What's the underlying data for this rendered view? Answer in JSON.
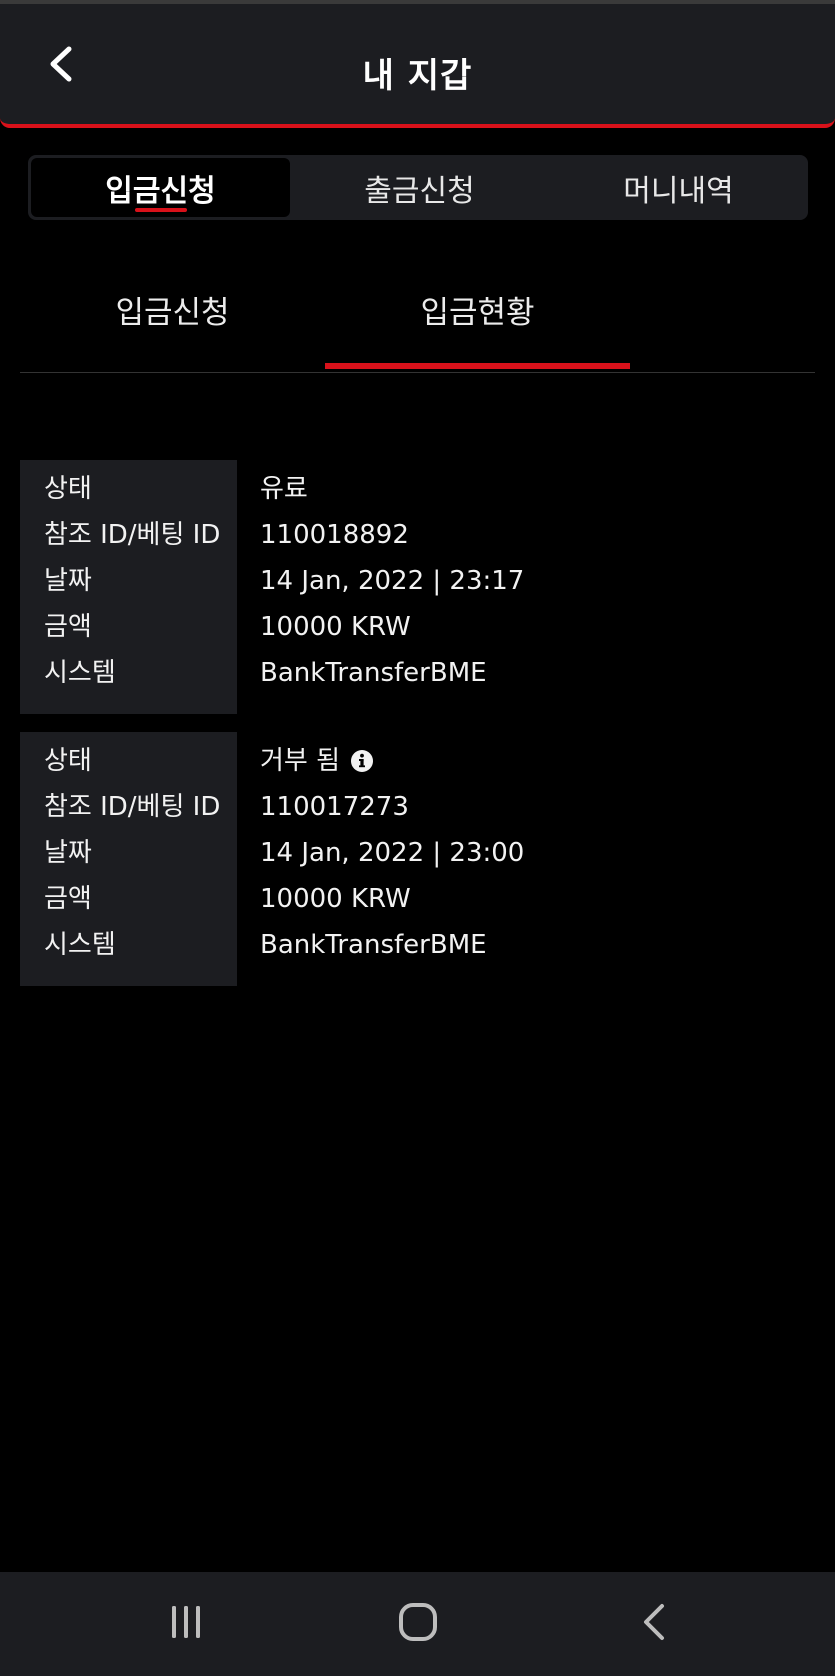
{
  "header": {
    "title": "내 지갑",
    "back_icon": "chevron-left-icon"
  },
  "main_tabs": [
    {
      "label": "입금신청",
      "active": true
    },
    {
      "label": "출금신청",
      "active": false
    },
    {
      "label": "머니내역",
      "active": false
    }
  ],
  "sub_tabs": [
    {
      "label": "입금신청",
      "active": false
    },
    {
      "label": "입금현황",
      "active": true
    }
  ],
  "records": [
    {
      "status_label": "상태",
      "status_value": "유료",
      "ref_label": "참조 ID/베팅 ID",
      "ref_value": "110018892",
      "date_label": "날짜",
      "date_value": "14 Jan, 2022 | 23:17",
      "amount_label": "금액",
      "amount_value": "10000 KRW",
      "system_label": "시스템",
      "system_value": "BankTransferBME"
    },
    {
      "status_label": "상태",
      "status_value": "거부 됨",
      "status_icon": "info-icon",
      "ref_label": "참조 ID/베팅 ID",
      "ref_value": "110017273",
      "date_label": "날짜",
      "date_value": "14 Jan, 2022 | 23:00",
      "amount_label": "금액",
      "amount_value": "10000 KRW",
      "system_label": "시스템",
      "system_value": "BankTransferBME"
    }
  ],
  "nav_bar": {
    "recent_icon": "recent-apps-icon",
    "home_icon": "home-icon",
    "back_icon": "back-icon"
  },
  "colors": {
    "accent": "#d8111a",
    "panel": "#1c1d21",
    "background": "#000000"
  }
}
